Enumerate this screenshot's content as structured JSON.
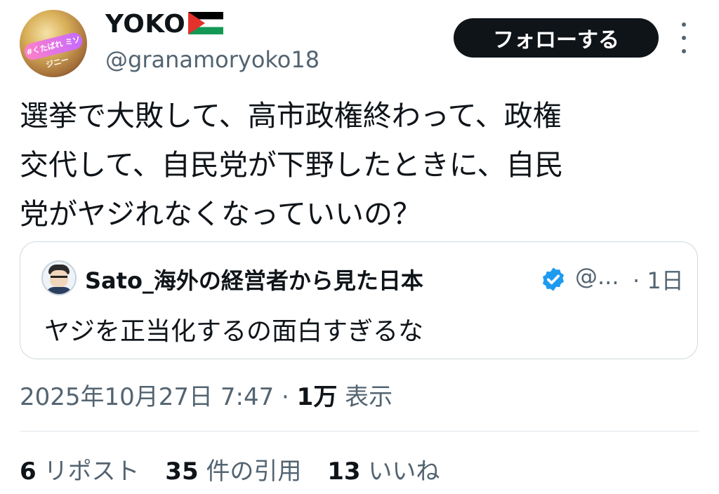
{
  "author": {
    "display_name": "YOKO",
    "flag_icon": "palestine-flag-icon",
    "handle": "@granamoryoko18",
    "avatar_badge_text": "#くたばれ ミソジニー"
  },
  "follow_button": {
    "label": "フォローする"
  },
  "tweet": {
    "lines": [
      "選挙で大敗して、高市政権終わって、政権",
      "交代して、自民党が下野したときに、自民",
      "党がヤジれなくなっていいの？"
    ]
  },
  "quote": {
    "name": "Sato_海外の経営者から見た日本",
    "handle": "@...",
    "time": "· 1日",
    "text": "ヤジを正当化するの面白すぎるな",
    "verified_color": "#1d9bf0"
  },
  "meta": {
    "datetime": "2025年10月27日 7:47",
    "separator": " · ",
    "views_count": "1万",
    "views_label": "表示"
  },
  "stats": {
    "reposts_count": "6",
    "reposts_label": "リポスト",
    "quotes_count": "35",
    "quotes_label": "件の引用",
    "likes_count": "13",
    "likes_label": "いいね"
  },
  "colors": {
    "text": "#0f1419",
    "secondary": "#536471",
    "border": "#cfd9de",
    "button_bg": "#0f1419"
  }
}
